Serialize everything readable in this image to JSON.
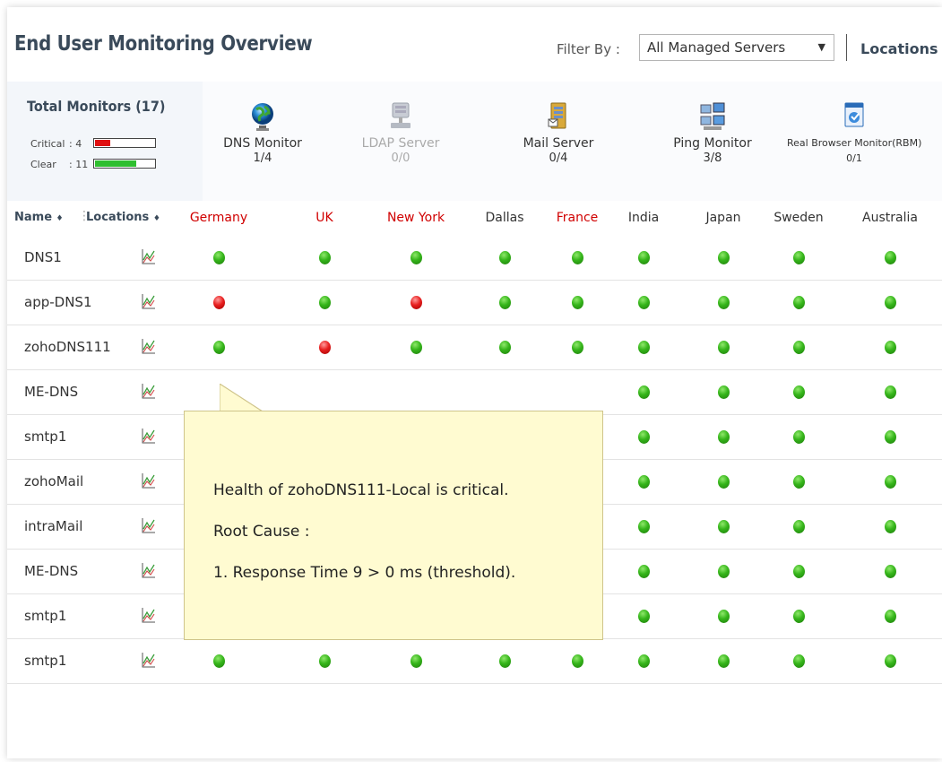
{
  "header": {
    "title": "End User Monitoring Overview",
    "filter_label": "Filter By :",
    "filter_value": "All Managed Servers",
    "locations_link": "Locations"
  },
  "summary": {
    "total_label": "Total Monitors (17)",
    "critical_label": "Critical",
    "critical_value": ": 4",
    "critical_fraction": 0.25,
    "clear_label": "Clear",
    "clear_value": ": 11",
    "clear_fraction": 0.69,
    "monitors": [
      {
        "name": "DNS Monitor",
        "count": "1/4",
        "icon": "globe-icon",
        "enabled": true
      },
      {
        "name": "LDAP Server",
        "count": "0/0",
        "icon": "ldap-server-icon",
        "enabled": false
      },
      {
        "name": "Mail Server",
        "count": "0/4",
        "icon": "mail-server-icon",
        "enabled": true
      },
      {
        "name": "Ping Monitor",
        "count": "3/8",
        "icon": "ping-computers-icon",
        "enabled": true
      },
      {
        "name": "Real Browser Monitor(RBM)",
        "count": "0/1",
        "icon": "browser-icon",
        "enabled": true
      }
    ]
  },
  "table": {
    "name_header": "Name",
    "locations_header": "Locations",
    "locations": [
      {
        "name": "Germany",
        "critical": true
      },
      {
        "name": "UK",
        "critical": true
      },
      {
        "name": "New York",
        "critical": true
      },
      {
        "name": "Dallas",
        "critical": false
      },
      {
        "name": "France",
        "critical": true
      },
      {
        "name": "India",
        "critical": false
      },
      {
        "name": "Japan",
        "critical": false
      },
      {
        "name": "Sweden",
        "critical": false
      },
      {
        "name": "Australia",
        "critical": false
      }
    ],
    "rows": [
      {
        "name": "DNS1",
        "status": [
          "up",
          "up",
          "up",
          "up",
          "up",
          "up",
          "up",
          "up",
          "up"
        ]
      },
      {
        "name": "app-DNS1",
        "status": [
          "down",
          "up",
          "down",
          "up",
          "up",
          "up",
          "up",
          "up",
          "up"
        ]
      },
      {
        "name": "zohoDNS111",
        "status": [
          "up",
          "down",
          "up",
          "up",
          "up",
          "up",
          "up",
          "up",
          "up"
        ]
      },
      {
        "name": "ME-DNS",
        "status": [
          "",
          "",
          "",
          "",
          "",
          "up",
          "up",
          "up",
          "up"
        ]
      },
      {
        "name": "smtp1",
        "status": [
          "",
          "",
          "",
          "",
          "",
          "up",
          "up",
          "up",
          "up"
        ]
      },
      {
        "name": "zohoMail",
        "status": [
          "",
          "",
          "",
          "",
          "",
          "up",
          "up",
          "up",
          "up"
        ]
      },
      {
        "name": "intraMail",
        "status": [
          "",
          "",
          "",
          "",
          "",
          "up",
          "up",
          "up",
          "up"
        ]
      },
      {
        "name": "ME-DNS",
        "status": [
          "",
          "",
          "",
          "",
          "",
          "up",
          "up",
          "up",
          "up"
        ]
      },
      {
        "name": "smtp1",
        "status": [
          "up",
          "up",
          "up",
          "up",
          "up",
          "up",
          "up",
          "up",
          "up"
        ]
      },
      {
        "name": "smtp1",
        "status": [
          "up",
          "up",
          "up",
          "up",
          "up",
          "up",
          "up",
          "up",
          "up"
        ]
      }
    ]
  },
  "tooltip": {
    "line1": "Health of zohoDNS111-Local is critical.",
    "line2": "Root Cause :",
    "line3": "1. Response Time 9 > 0 ms (threshold)."
  },
  "colors": {
    "critical": "#e81f1f",
    "clear": "#35b51a",
    "header_text": "#3a4a5a",
    "location_critical": "#d00000"
  }
}
